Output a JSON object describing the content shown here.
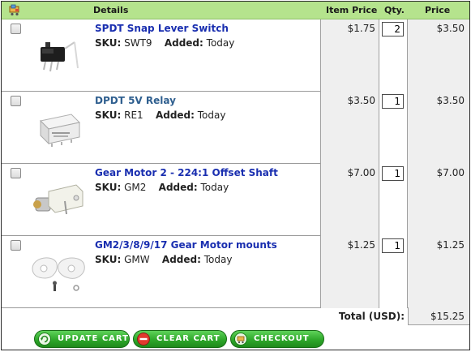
{
  "header": {
    "details": "Details",
    "item_price": "Item Price",
    "qty": "Qty.",
    "price": "Price"
  },
  "labels": {
    "sku": "SKU:",
    "added": "Added:"
  },
  "items": [
    {
      "name": "SPDT Snap Lever Switch",
      "sku": "SWT9",
      "added": "Today",
      "unit_price": "$1.75",
      "qty": "2",
      "line_total": "$3.50"
    },
    {
      "name": "DPDT 5V Relay",
      "sku": "RE1",
      "added": "Today",
      "unit_price": "$3.50",
      "qty": "1",
      "line_total": "$3.50"
    },
    {
      "name": "Gear Motor 2 - 224:1 Offset Shaft",
      "sku": "GM2",
      "added": "Today",
      "unit_price": "$7.00",
      "qty": "1",
      "line_total": "$7.00"
    },
    {
      "name": "GM2/3/8/9/17 Gear Motor mounts",
      "sku": "GMW",
      "added": "Today",
      "unit_price": "$1.25",
      "qty": "1",
      "line_total": "$1.25"
    }
  ],
  "total": {
    "label": "Total (USD):",
    "value": "$15.25"
  },
  "buttons": {
    "update": "UPDATE CART",
    "clear": "CLEAR CART",
    "checkout": "CHECKOUT"
  },
  "colors": {
    "header_bg": "#b5e38d",
    "link": "#1a2fb0",
    "button_green": "#2ea72a"
  }
}
